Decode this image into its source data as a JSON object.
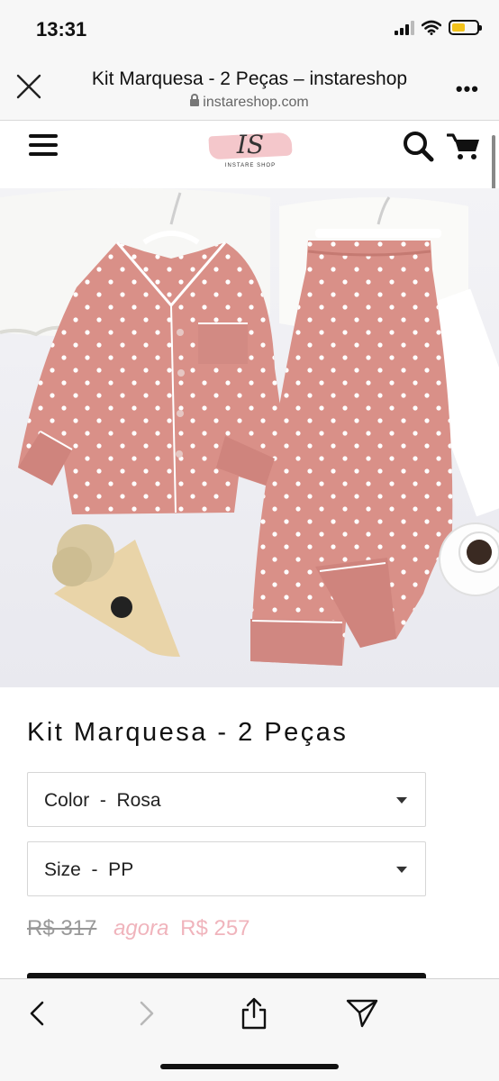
{
  "status_bar": {
    "time": "13:31"
  },
  "browser": {
    "page_title": "Kit Marquesa - 2 Peças – instareshop",
    "domain": "instareshop.com"
  },
  "site": {
    "logo_mark": "IS",
    "logo_text": "INSTARE SHOP"
  },
  "product": {
    "title": "Kit Marquesa - 2 Peças",
    "color_select": "Color  -  Rosa",
    "size_select": "Size  -  PP",
    "old_price": "R$ 317",
    "now_label": "agora",
    "new_price": "R$ 257"
  },
  "colors": {
    "accent_pink": "#f0b4bc",
    "pajama_pink": "#d99088"
  },
  "icons": {
    "close": "close-icon",
    "more": "more-icon",
    "menu": "hamburger-icon",
    "search": "search-icon",
    "cart": "cart-icon",
    "back": "chevron-left-icon",
    "forward": "chevron-right-icon",
    "share": "share-icon",
    "send": "send-icon"
  }
}
